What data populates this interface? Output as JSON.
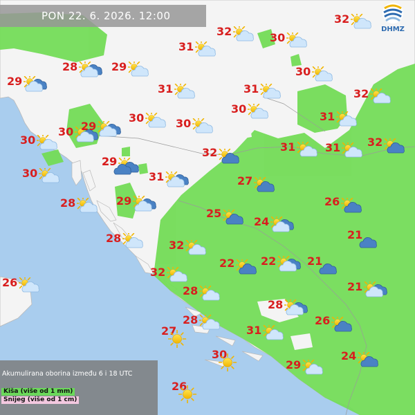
{
  "header": {
    "datetime": "PON  22. 6. 2026. 12:00"
  },
  "logo": {
    "label": "DHMZ",
    "accent": "#2e6bb0"
  },
  "legend": {
    "title": "Akumulirana oborina između 6 i 18 UTC",
    "rain": "Kiša (više od 1 mm)",
    "snow": "Snijeg (više od 1 cm)",
    "rain_color": "#6bd85a",
    "snow_color": "#f3c8e0"
  },
  "colors": {
    "sea": "#a9cdee",
    "land": "#f4f4f4",
    "precip": "#74dc58",
    "temperature": "#d81e1e"
  },
  "stations": [
    {
      "temp": "32",
      "icon": "partly-cloudy-icon"
    },
    {
      "temp": "32",
      "icon": "partly-cloudy-icon"
    },
    {
      "temp": "30",
      "icon": "partly-cloudy-icon"
    },
    {
      "temp": "31",
      "icon": "partly-cloudy-icon"
    },
    {
      "temp": "28",
      "icon": "partly-cloudy-showers-icon"
    },
    {
      "temp": "29",
      "icon": "partly-cloudy-icon"
    },
    {
      "temp": "30",
      "icon": "partly-cloudy-icon"
    },
    {
      "temp": "29",
      "icon": "partly-cloudy-showers-icon"
    },
    {
      "temp": "31",
      "icon": "partly-cloudy-icon"
    },
    {
      "temp": "31",
      "icon": "partly-cloudy-icon"
    },
    {
      "temp": "32",
      "icon": "partly-cloudy-icon"
    },
    {
      "temp": "30",
      "icon": "partly-cloudy-icon"
    },
    {
      "temp": "30",
      "icon": "partly-cloudy-icon"
    },
    {
      "temp": "31",
      "icon": "partly-cloudy-icon"
    },
    {
      "temp": "30",
      "icon": "partly-cloudy-showers-icon"
    },
    {
      "temp": "29",
      "icon": "partly-cloudy-showers-icon"
    },
    {
      "temp": "30",
      "icon": "partly-cloudy-icon"
    },
    {
      "temp": "30",
      "icon": "partly-cloudy-icon"
    },
    {
      "temp": "31",
      "icon": "partly-cloudy-icon"
    },
    {
      "temp": "31",
      "icon": "partly-cloudy-icon"
    },
    {
      "temp": "32",
      "icon": "partly-cloudy-rain-icon"
    },
    {
      "temp": "32",
      "icon": "partly-cloudy-rain-icon"
    },
    {
      "temp": "29",
      "icon": "partly-cloudy-rain-icon"
    },
    {
      "temp": "29",
      "icon": "rain-cloud-icon"
    },
    {
      "temp": "30",
      "icon": "partly-cloudy-icon"
    },
    {
      "temp": "31",
      "icon": "partly-cloudy-showers-icon"
    },
    {
      "temp": "27",
      "icon": "partly-cloudy-rain-icon"
    },
    {
      "temp": "28",
      "icon": "partly-cloudy-icon"
    },
    {
      "temp": "29",
      "icon": "partly-cloudy-showers-icon"
    },
    {
      "temp": "25",
      "icon": "partly-cloudy-rain-icon"
    },
    {
      "temp": "24",
      "icon": "partly-cloudy-showers-icon"
    },
    {
      "temp": "26",
      "icon": "partly-cloudy-rain-icon"
    },
    {
      "temp": "28",
      "icon": "partly-cloudy-icon"
    },
    {
      "temp": "32",
      "icon": "partly-cloudy-icon"
    },
    {
      "temp": "21",
      "icon": "rain-cloud-icon"
    },
    {
      "temp": "22",
      "icon": "partly-cloudy-rain-icon"
    },
    {
      "temp": "22",
      "icon": "partly-cloudy-showers-icon"
    },
    {
      "temp": "21",
      "icon": "rain-cloud-icon"
    },
    {
      "temp": "26",
      "icon": "partly-cloudy-icon"
    },
    {
      "temp": "32",
      "icon": "partly-cloudy-icon"
    },
    {
      "temp": "28",
      "icon": "partly-cloudy-icon"
    },
    {
      "temp": "21",
      "icon": "partly-cloudy-showers-icon"
    },
    {
      "temp": "28",
      "icon": "partly-cloudy-showers-icon"
    },
    {
      "temp": "28",
      "icon": "partly-cloudy-icon"
    },
    {
      "temp": "26",
      "icon": "partly-cloudy-rain-icon"
    },
    {
      "temp": "27",
      "icon": "sun-icon"
    },
    {
      "temp": "31",
      "icon": "partly-cloudy-icon"
    },
    {
      "temp": "30",
      "icon": "sun-icon"
    },
    {
      "temp": "24",
      "icon": "partly-cloudy-rain-icon"
    },
    {
      "temp": "29",
      "icon": "partly-cloudy-icon"
    },
    {
      "temp": "26",
      "icon": "sun-icon"
    }
  ]
}
